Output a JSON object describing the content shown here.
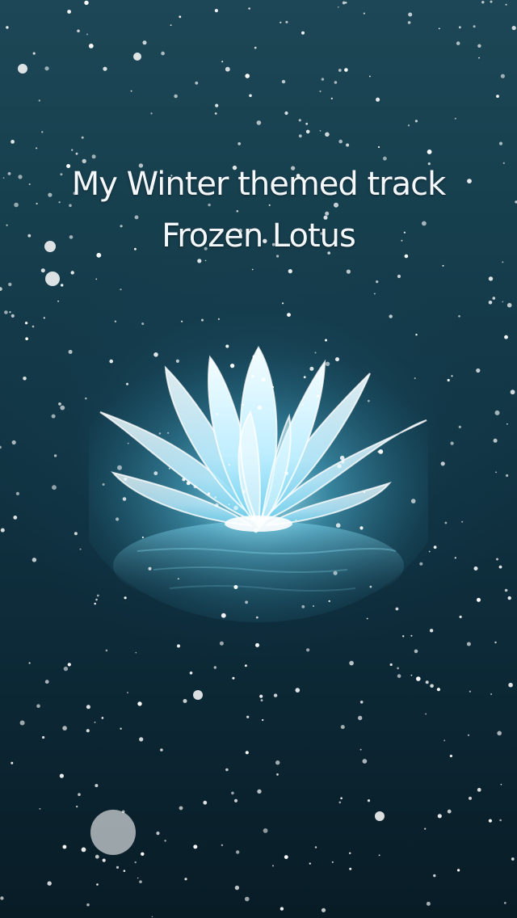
{
  "overlay": {
    "line1": "My Winter themed track",
    "line2": "Frozen Lotus"
  },
  "illustration": {
    "subject": "glowing-ice-lotus-on-water",
    "colors": {
      "background_top": "#1d4756",
      "background_bottom": "#081c26",
      "glow": "#7fe3ff",
      "petal": "#e8fbff",
      "snow": "#ffffff"
    }
  }
}
